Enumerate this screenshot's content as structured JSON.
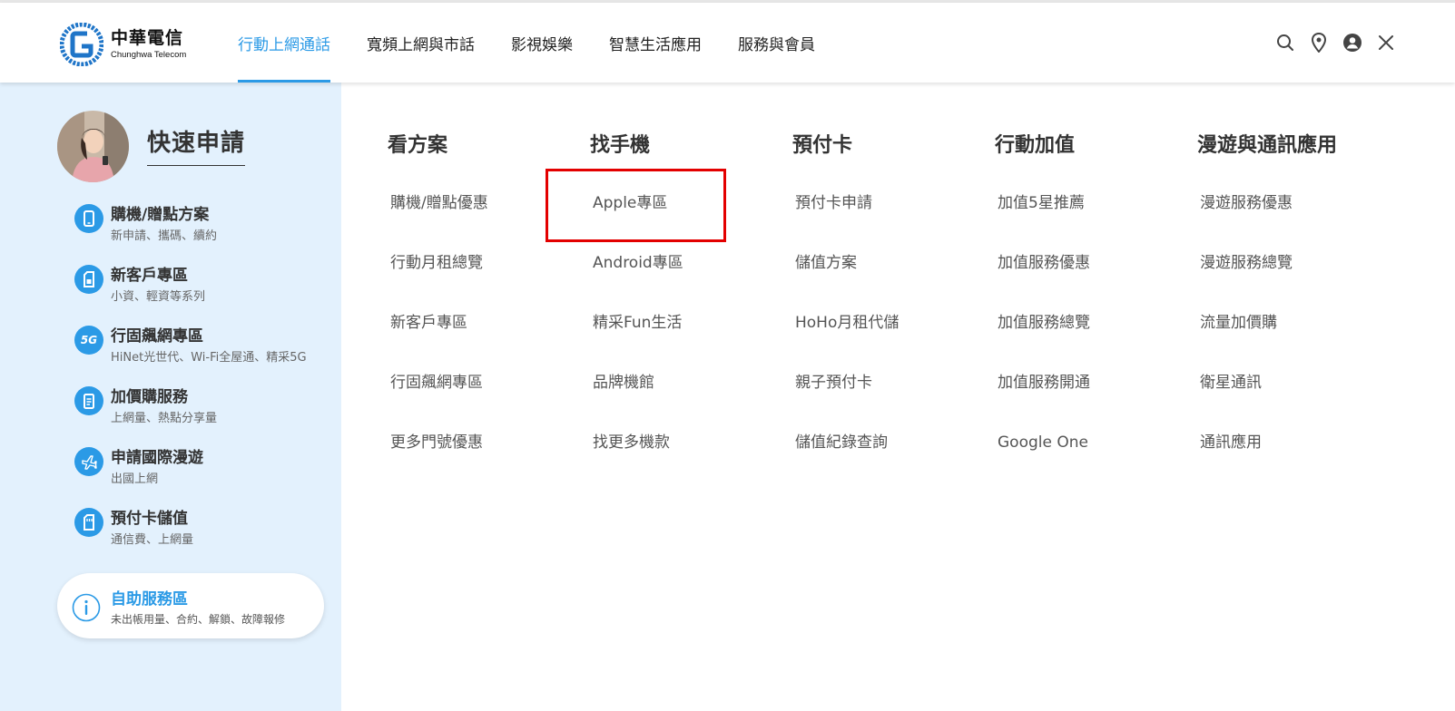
{
  "brand": {
    "name_zh": "中華電信",
    "name_en": "Chunghwa Telecom"
  },
  "nav": {
    "items": [
      "行動上網通話",
      "寬頻上網與市話",
      "影視娛樂",
      "智慧生活應用",
      "服務與會員"
    ],
    "active_index": 0
  },
  "tools": {
    "icons": [
      "search-icon",
      "location-pin-icon",
      "user-account-icon",
      "close-icon"
    ]
  },
  "quick_apply": {
    "title": "快速申請",
    "items": [
      {
        "icon": "phone-icon",
        "label": "購機/贈點方案",
        "sub": "新申請、攜碼、續約"
      },
      {
        "icon": "sim-card-icon",
        "label": "新客戶專區",
        "sub": "小資、輕資等系列"
      },
      {
        "icon": "5g-icon",
        "icon_text": "5G",
        "label": "行固飆網專區",
        "sub": "HiNet光世代、Wi-Fi全屋通、精采5G"
      },
      {
        "icon": "clipboard-icon",
        "label": "加價購服務",
        "sub": "上網量、熱點分享量"
      },
      {
        "icon": "airplane-icon",
        "label": "申請國際漫遊",
        "sub": "出國上網"
      },
      {
        "icon": "prepaid-card-icon",
        "label": "預付卡儲值",
        "sub": "通信費、上網量"
      }
    ]
  },
  "self_service": {
    "title": "自助服務區",
    "sub": "未出帳用量、合約、解鎖、故障報修"
  },
  "menu": {
    "columns": [
      {
        "heading": "看方案",
        "links": [
          "購機/贈點優惠",
          "行動月租總覽",
          "新客戶專區",
          "行固飆網專區",
          "更多門號優惠"
        ]
      },
      {
        "heading": "找手機",
        "links": [
          "Apple專區",
          "Android專區",
          "精采Fun生活",
          "品牌機館",
          "找更多機款"
        ]
      },
      {
        "heading": "預付卡",
        "links": [
          "預付卡申請",
          "儲值方案",
          "HoHo月租代儲",
          "親子預付卡",
          "儲值紀錄查詢"
        ]
      },
      {
        "heading": "行動加值",
        "links": [
          "加值5星推薦",
          "加值服務優惠",
          "加值服務總覽",
          "加值服務開通",
          "Google One"
        ]
      },
      {
        "heading": "漫遊與通訊應用",
        "links": [
          "漫遊服務優惠",
          "漫遊服務總覽",
          "流量加價購",
          "衛星通訊",
          "通訊應用"
        ]
      }
    ]
  },
  "colors": {
    "accent": "#2b9ae6",
    "sidebar_bg": "#e3f1fd",
    "highlight": "#e30000"
  }
}
